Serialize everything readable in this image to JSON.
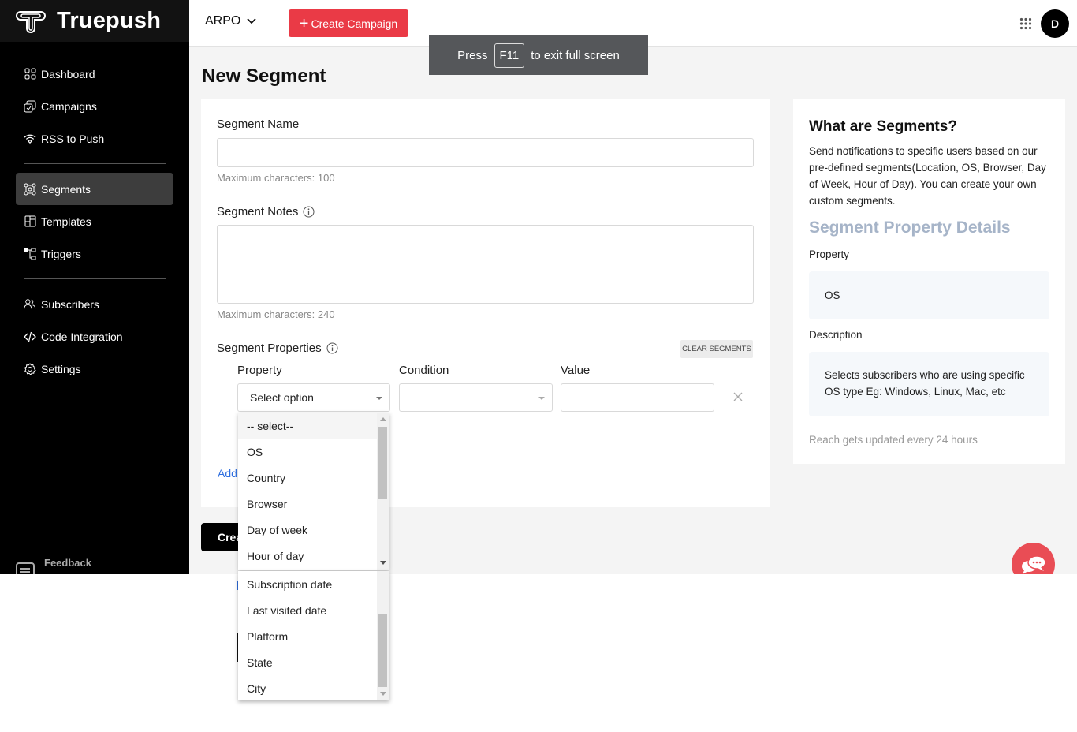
{
  "brand": {
    "name": "Truepush",
    "logo_icon": "truepush-logo-icon"
  },
  "sidebar": {
    "items": [
      {
        "label": "Dashboard",
        "icon": "dashboard-grid-icon",
        "active": false
      },
      {
        "label": "Campaigns",
        "icon": "campaigns-icon",
        "active": false
      },
      {
        "label": "RSS to Push",
        "icon": "wifi-icon",
        "active": false
      },
      {
        "label": "Segments",
        "icon": "segments-icon",
        "active": true
      },
      {
        "label": "Templates",
        "icon": "templates-icon",
        "active": false
      },
      {
        "label": "Triggers",
        "icon": "triggers-icon",
        "active": false
      },
      {
        "label": "Subscribers",
        "icon": "users-icon",
        "active": false
      },
      {
        "label": "Code Integration",
        "icon": "code-icon",
        "active": false
      },
      {
        "label": "Settings",
        "icon": "gear-icon",
        "active": false
      }
    ],
    "feedback_label": "Feedback"
  },
  "topbar": {
    "org_name": "ARPO",
    "create_campaign_label": "Create Campaign",
    "avatar_initial": "D"
  },
  "fullscreen_toast": {
    "prefix": "Press",
    "key": "F11",
    "suffix": "to exit full screen"
  },
  "page": {
    "title": "New Segment"
  },
  "form": {
    "segment_name_label": "Segment Name",
    "segment_name_value": "",
    "segment_name_hint": "Maximum characters: 100",
    "segment_notes_label": "Segment Notes",
    "segment_notes_value": "",
    "segment_notes_hint": "Maximum characters: 240",
    "segment_properties_label": "Segment Properties",
    "clear_segments_label": "CLEAR SEGMENTS",
    "columns": {
      "property": "Property",
      "condition": "Condition",
      "value": "Value"
    },
    "property_select_value": "Select option",
    "condition_select_value": "",
    "value_input_value": "",
    "add_link_label": "Add",
    "create_button_label": "Crea"
  },
  "property_dropdown": {
    "options": [
      "-- select--",
      "OS",
      "Country",
      "Browser",
      "Day of week",
      "Hour of day"
    ],
    "highlighted_index": 0,
    "options_continued": [
      "Subscription date",
      "Last visited date",
      "Platform",
      "State",
      "City"
    ]
  },
  "info_panel": {
    "title": "What are Segments?",
    "text": "Send notifications to specific users based on our pre-defined segments(Location, OS, Browser, Day of Week, Hour of Day). You can create your own custom segments.",
    "details_title": "Segment Property Details",
    "property_label": "Property",
    "property_value": "OS",
    "description_label": "Description",
    "description_value": "Selects subscribers who are using specific OS type Eg: Windows, Linux, Mac, etc",
    "reach_note": "Reach gets updated every 24 hours"
  },
  "colors": {
    "accent_red": "#ea3a46",
    "sidebar_bg": "#000000",
    "active_item_bg": "#3d3d3d",
    "link_blue": "#2f6fe0",
    "details_title": "#a6b4c8",
    "chat_button": "#e94d55"
  }
}
